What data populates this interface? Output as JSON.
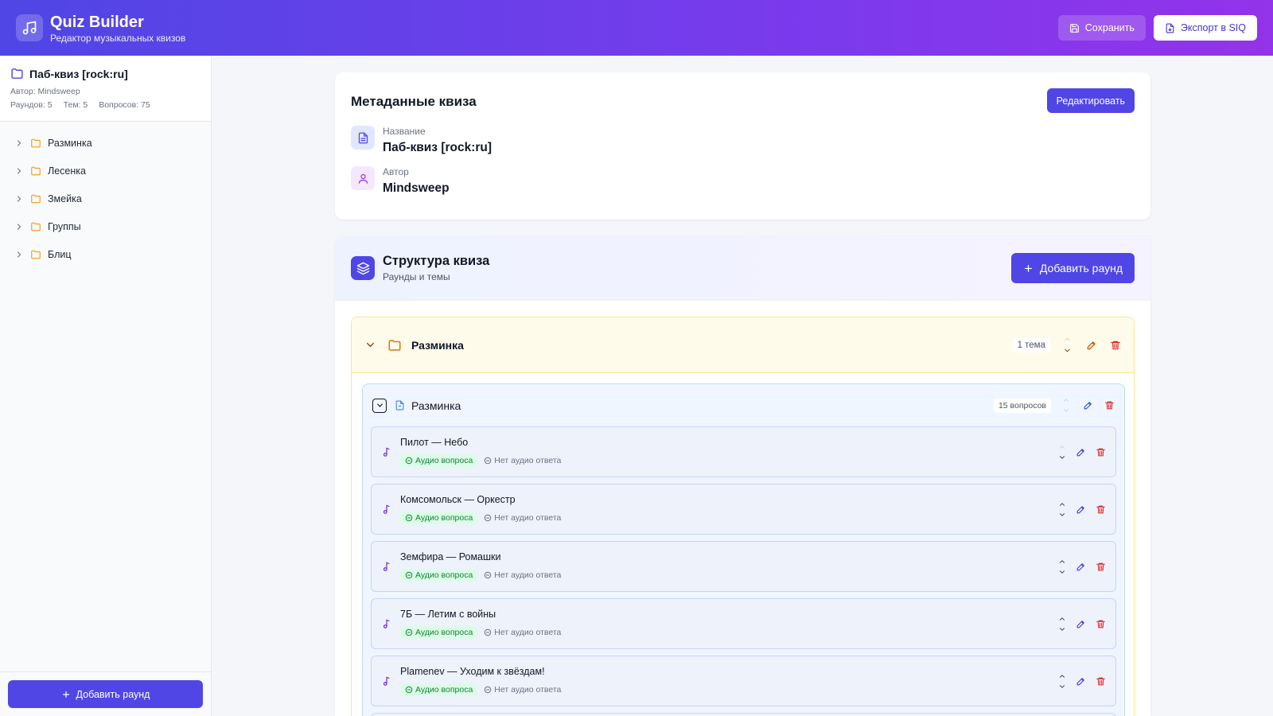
{
  "header": {
    "title": "Quiz Builder",
    "subtitle": "Редактор музыкальных квизов",
    "save_label": "Сохранить",
    "export_label": "Экспорт в SIQ"
  },
  "sidebar": {
    "quiz_title": "Паб-квиз [rock:ru]",
    "author_line": "Автор: Mindsweep",
    "stats": [
      "Раундов: 5",
      "Тем: 5",
      "Вопросов: 75"
    ],
    "items": [
      {
        "label": "Разминка",
        "icon": "folder-icon"
      },
      {
        "label": "Лесенка",
        "icon": "folder-icon"
      },
      {
        "label": "Змейка",
        "icon": "folder-icon"
      },
      {
        "label": "Группы",
        "icon": "folder-icon"
      },
      {
        "label": "Блиц",
        "icon": "folder-icon"
      }
    ],
    "add_round_label": "Добавить раунд"
  },
  "metadata": {
    "title": "Метаданные квиза",
    "edit_label": "Редактировать",
    "name_label": "Название",
    "name_value": "Паб-квиз [rock:ru]",
    "author_label": "Автор",
    "author_value": "Mindsweep"
  },
  "structure": {
    "title": "Структура квиза",
    "subtitle": "Раунды и темы",
    "add_round_label": "Добавить раунд",
    "round": {
      "name": "Разминка",
      "count": "1 тема",
      "theme": {
        "name": "Разминка",
        "count": "15 вопросов",
        "questions": [
          {
            "title": "Пилот — Небо",
            "audio_q": "Аудио вопроса",
            "audio_a": "Нет аудио ответа"
          },
          {
            "title": "Комсомольск — Оркестр",
            "audio_q": "Аудио вопроса",
            "audio_a": "Нет аудио ответа"
          },
          {
            "title": "Земфира — Ромашки",
            "audio_q": "Аудио вопроса",
            "audio_a": "Нет аудио ответа"
          },
          {
            "title": "7Б — Летим с войны",
            "audio_q": "Аудио вопроса",
            "audio_a": "Нет аудио ответа"
          },
          {
            "title": "Plamenev — Уходим к звёздам!",
            "audio_q": "Аудио вопроса",
            "audio_a": "Нет аудио ответа"
          }
        ]
      }
    }
  },
  "colors": {
    "accent": "#4f46e5",
    "folder": "#f59e0b",
    "danger": "#dc2626",
    "success": "#15803d"
  }
}
